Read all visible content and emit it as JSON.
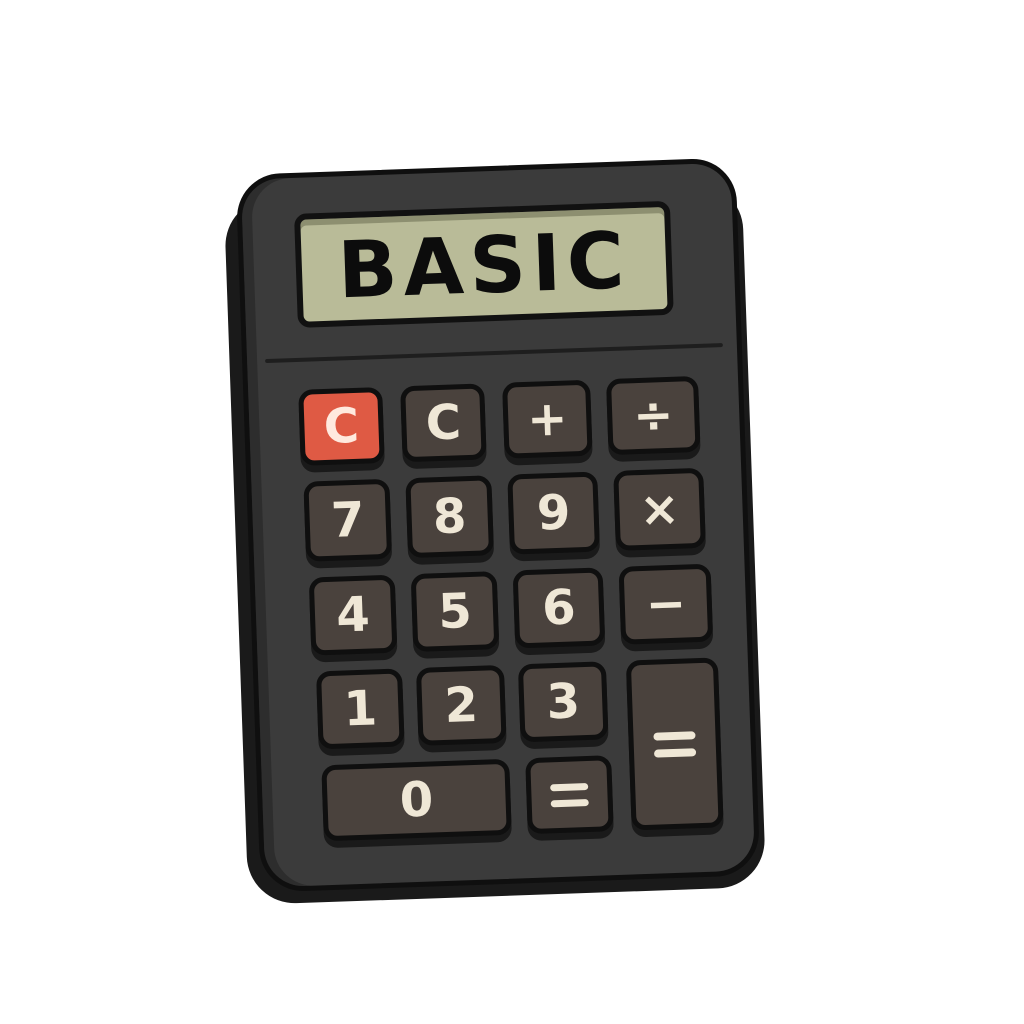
{
  "display": {
    "text": "BASIC"
  },
  "keys": {
    "clear_red": "C",
    "clear": "C",
    "plus": "+",
    "divide": "÷",
    "seven": "7",
    "eight": "8",
    "nine": "9",
    "multiply": "×",
    "four": "4",
    "five": "5",
    "six": "6",
    "minus": "−",
    "one": "1",
    "two": "2",
    "three": "3",
    "zero": "0"
  },
  "colors": {
    "body": "#3b3b3b",
    "display": "#b9bb98",
    "key": "#4a423d",
    "clear_key": "#df5a44",
    "key_text": "#efe7d6"
  }
}
